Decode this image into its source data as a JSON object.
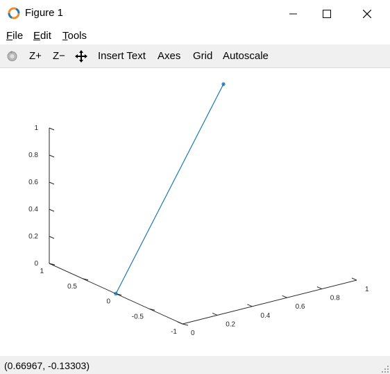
{
  "window": {
    "title": "Figure 1"
  },
  "menu": {
    "file": "File",
    "edit": "Edit",
    "tools": "Tools"
  },
  "toolbar": {
    "zoom_in": "Z+",
    "zoom_out": "Z−",
    "insert_text": "Insert Text",
    "axes": "Axes",
    "grid": "Grid",
    "autoscale": "Autoscale"
  },
  "status": {
    "coords": "(0.66967, -0.13303)"
  },
  "colors": {
    "line": "#1f77b4",
    "axis": "#262626",
    "toolbar_bg": "#f0f0f0"
  },
  "chart_data": {
    "type": "line",
    "projection": "3d",
    "series": [
      {
        "x": [
          0,
          1
        ],
        "y": [
          0,
          1
        ],
        "z": [
          0,
          1
        ]
      }
    ],
    "xlim": [
      0,
      1
    ],
    "ylim": [
      -1,
      1
    ],
    "zlim": [
      0,
      1
    ],
    "x_ticks": [
      "0",
      "0.2",
      "0.4",
      "0.6",
      "0.8",
      "1"
    ],
    "y_ticks": [
      "-1",
      "-0.5",
      "0",
      "0.5",
      "1"
    ],
    "z_ticks": [
      "0",
      "0.2",
      "0.4",
      "0.6",
      "0.8",
      "1"
    ],
    "grid": false,
    "title": "",
    "xlabel": "",
    "ylabel": "",
    "zlabel": ""
  }
}
